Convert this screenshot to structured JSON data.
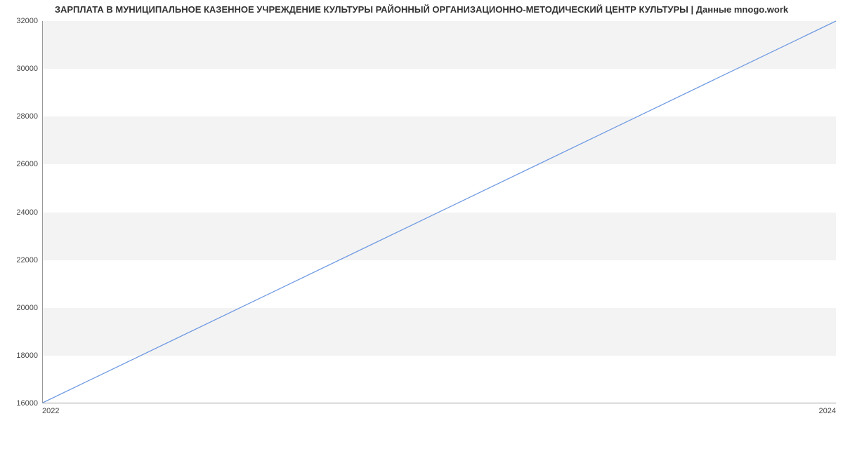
{
  "chart_data": {
    "type": "line",
    "title": "ЗАРПЛАТА В МУНИЦИПАЛЬНОЕ КАЗЕННОЕ УЧРЕЖДЕНИЕ КУЛЬТУРЫ РАЙОННЫЙ ОРГАНИЗАЦИОННО-МЕТОДИЧЕСКИЙ ЦЕНТР КУЛЬТУРЫ | Данные mnogo.work",
    "x": [
      2022,
      2024
    ],
    "values": [
      16000,
      32000
    ],
    "xlabel": "",
    "ylabel": "",
    "xlim": [
      2022,
      2024
    ],
    "ylim": [
      16000,
      32000
    ],
    "y_ticks": [
      16000,
      18000,
      20000,
      22000,
      24000,
      26000,
      28000,
      30000,
      32000
    ],
    "x_ticks": [
      2022,
      2024
    ],
    "grid": true,
    "line_color": "#6f9ae3"
  }
}
